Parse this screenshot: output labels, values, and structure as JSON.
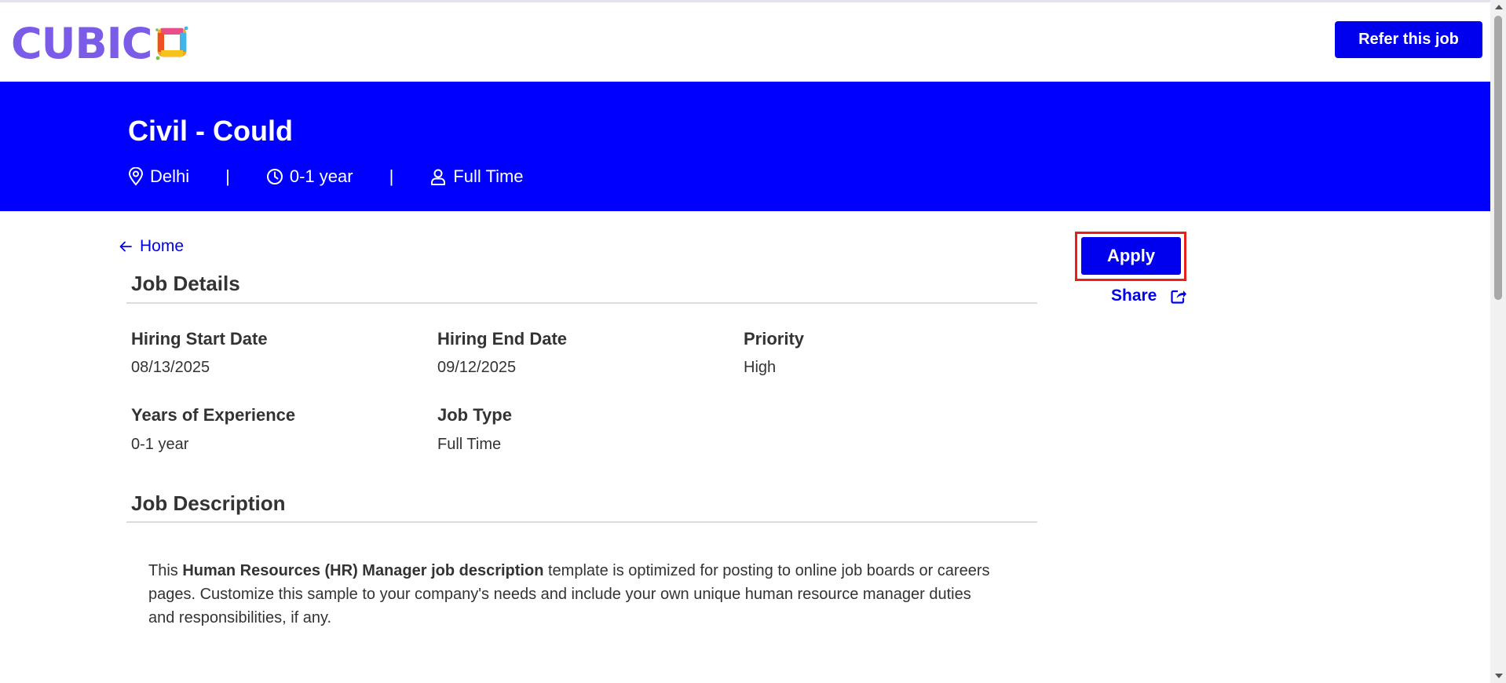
{
  "header": {
    "logo_text": "CUBIC",
    "refer_label": "Refer this job"
  },
  "job": {
    "title": "Civil - Could",
    "location": "Delhi",
    "experience": "0-1 year",
    "type": "Full Time",
    "separator": "|"
  },
  "nav": {
    "back_label": "Home"
  },
  "details": {
    "section_title": "Job Details",
    "fields": [
      {
        "label": "Hiring Start Date",
        "value": "08/13/2025"
      },
      {
        "label": "Hiring End Date",
        "value": "09/12/2025"
      },
      {
        "label": "Priority",
        "value": "High"
      },
      {
        "label": "Years of Experience",
        "value": "0-1 year"
      },
      {
        "label": "Job Type",
        "value": "Full Time"
      }
    ]
  },
  "description": {
    "section_title": "Job Description",
    "prefix": "This ",
    "bold": "Human Resources (HR) Manager job description",
    "suffix": " template is optimized for posting to online job boards or careers pages. Customize this sample to your company's needs and include your own unique human resource manager duties and responsibilities, if any."
  },
  "actions": {
    "apply_label": "Apply",
    "share_label": "Share"
  },
  "colors": {
    "brand": "#0000ff",
    "button": "#0000ee",
    "logo": "#7b5ce8",
    "highlight": "#e8201a"
  },
  "icons": [
    "location-pin-icon",
    "clock-icon",
    "user-icon",
    "arrow-left-icon",
    "share-icon"
  ]
}
